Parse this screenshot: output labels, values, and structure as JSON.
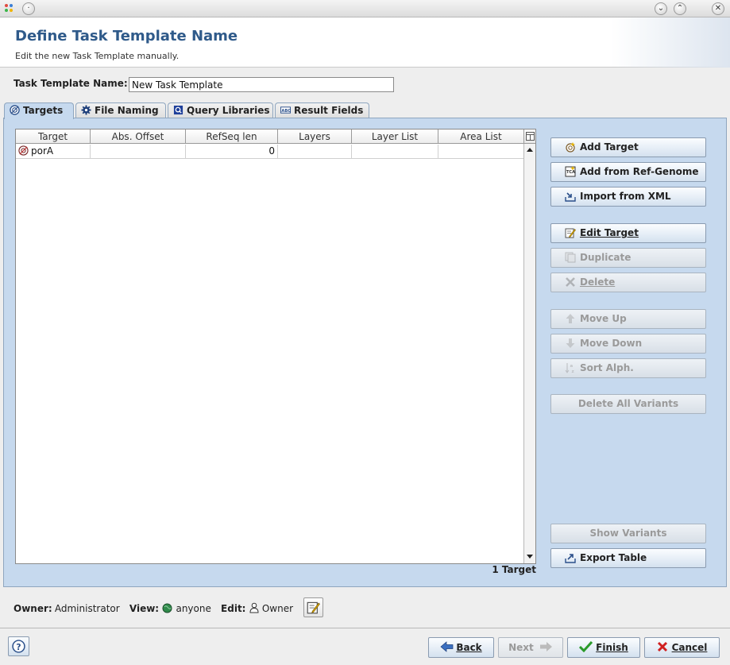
{
  "header": {
    "title": "Define Task Template Name",
    "subtitle": "Edit the new Task Template manually."
  },
  "name_field": {
    "label": "Task Template Name:",
    "value": "New Task Template"
  },
  "tabs": [
    {
      "label": "Targets",
      "icon": "target-icon",
      "active": true
    },
    {
      "label": "File Naming",
      "icon": "gear-icon",
      "active": false
    },
    {
      "label": "Query Libraries",
      "icon": "query-icon",
      "active": false
    },
    {
      "label": "Result Fields",
      "icon": "abc-fields-icon",
      "active": false
    }
  ],
  "table": {
    "columns": [
      "Target",
      "Abs. Offset",
      "RefSeq len",
      "Layers",
      "Layer List",
      "Area List"
    ],
    "rows": [
      {
        "target": "porA",
        "abs_offset": "",
        "refseq_len": "0",
        "layers": "",
        "layer_list": "",
        "area_list": ""
      }
    ],
    "count_label": "1 Target"
  },
  "buttons": {
    "add_target": "Add Target",
    "add_from_ref": "Add from Ref-Genome",
    "import_xml": "Import from XML",
    "edit_target": "Edit Target",
    "duplicate": "Duplicate",
    "delete": "Delete",
    "move_up": "Move Up",
    "move_down": "Move Down",
    "sort_alph": "Sort Alph.",
    "delete_all_variants": "Delete All Variants",
    "show_variants": "Show Variants",
    "export_table": "Export Table"
  },
  "ownership": {
    "owner_label": "Owner:",
    "owner_value": "Administrator",
    "view_label": "View:",
    "view_value": "anyone",
    "edit_label": "Edit:",
    "edit_value": "Owner"
  },
  "nav": {
    "back": "Back",
    "next": "Next",
    "finish": "Finish",
    "cancel": "Cancel"
  },
  "colors": {
    "accent_title": "#2f5a8a",
    "panel": "#c6d9ee"
  }
}
